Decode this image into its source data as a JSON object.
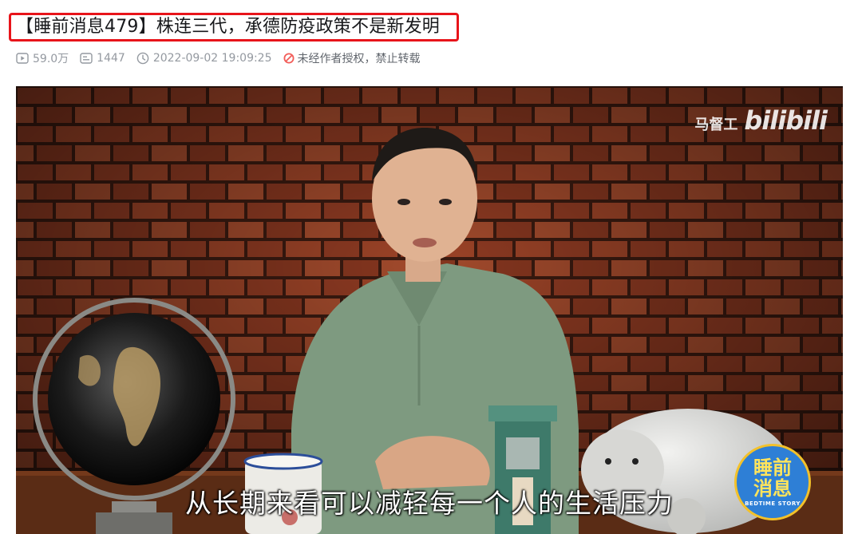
{
  "video": {
    "title": "【睡前消息479】株连三代，承德防疫政策不是新发明",
    "views": "59.0万",
    "danmaku": "1447",
    "datetime": "2022-09-02 19:09:25",
    "copyright_notice": "未经作者授权，禁止转载",
    "watermark_author": "马督工",
    "watermark_logo": "bilibili",
    "subtitle": "从长期来看可以减轻每一个人的生活压力",
    "show_badge_line1": "睡前",
    "show_badge_line2": "消息",
    "show_badge_en": "BEDTIME STORY"
  },
  "icons": {
    "views": "play-count-icon",
    "danmaku": "danmaku-icon",
    "time": "clock-icon",
    "forbidden": "no-repost-icon"
  },
  "colors": {
    "title_border": "#e8141a",
    "meta_text": "#9499a0",
    "forbidden_icon": "#f25d59"
  }
}
